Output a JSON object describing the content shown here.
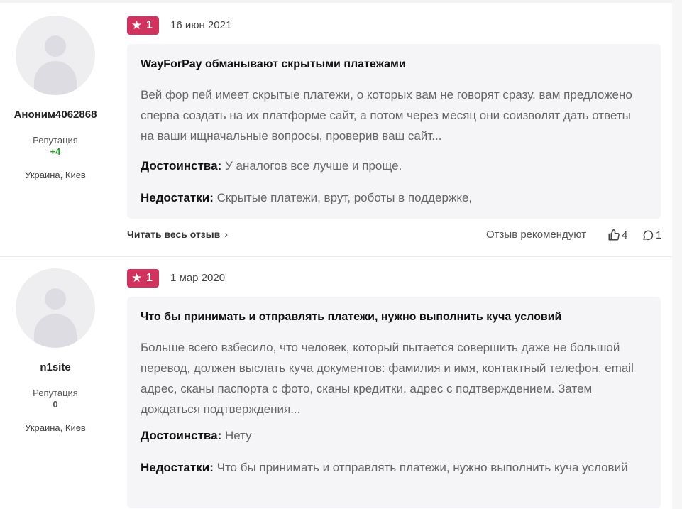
{
  "reviews": [
    {
      "author": {
        "name": "Аноним4062868",
        "reputation_label": "Репутация",
        "reputation_value": "+4",
        "location": "Украина, Киев"
      },
      "rating": "1",
      "date": "16 июн 2021",
      "title": "WayForPay обманывают скрытыми платежами",
      "text": "Вей фор пей имеет скрытые платежи, о которых вам не говорят сразу. вам предложено сперва создать на их платформе сайт, а потом через месяц они соизволят дать ответы на ваши ищначальные вопросы, проверив ваш сайт...",
      "pros_label": "Достоинства:",
      "pros": "У аналогов все лучше и проще.",
      "cons_label": "Недостатки:",
      "cons": "Скрытые платежи, врут, роботы в поддержке,",
      "read_more": "Читать весь отзыв",
      "recommend": "Отзыв рекомендуют",
      "likes": "4",
      "comments": "1"
    },
    {
      "author": {
        "name": "n1site",
        "reputation_label": "Репутация",
        "reputation_value": "0",
        "location": "Украина, Киев"
      },
      "rating": "1",
      "date": "1 мар 2020",
      "title": "Что бы принимать и отправлять платежи, нужно выполнить куча условий",
      "text": "Больше всего взбесило, что человек, который пытается совершить даже не большой перевод, должен выслать куча документов: фамилия и имя, контактный телефон, email адрес, сканы паспорта с фото, сканы кредитки, адрес с подтверждением. Затем дождаться подтверждения...",
      "pros_label": "Достоинства:",
      "pros": "Нету",
      "cons_label": "Недостатки:",
      "cons": "Что бы принимать и отправлять платежи, нужно выполнить куча условий"
    }
  ],
  "icons": {
    "star": "star-icon",
    "like": "thumbs-up-icon",
    "comment": "comment-icon",
    "chevron": "chevron-right-icon",
    "avatar": "user-avatar-placeholder"
  },
  "colors": {
    "rating_badge": "#d0345e",
    "reputation_positive": "#2a9d2a",
    "card_background": "#f5f5f7"
  }
}
